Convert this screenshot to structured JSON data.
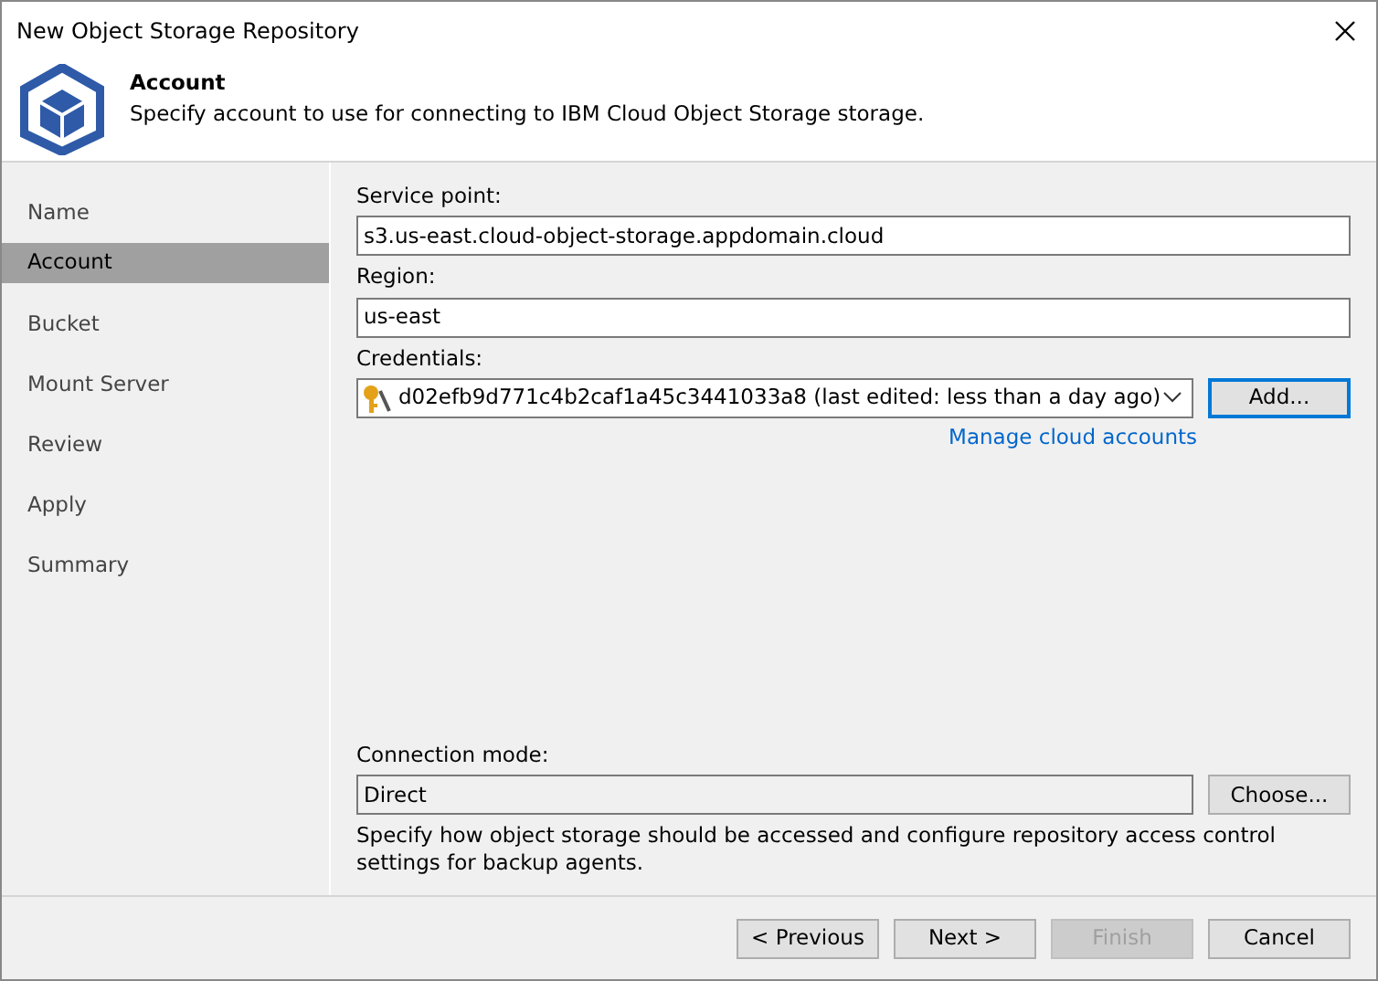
{
  "window": {
    "title": "New Object Storage Repository"
  },
  "header": {
    "title": "Account",
    "description": "Specify account to use for connecting to IBM Cloud Object Storage storage."
  },
  "steps": [
    {
      "label": "Name",
      "selected": false
    },
    {
      "label": "Account",
      "selected": true
    },
    {
      "label": "Bucket",
      "selected": false
    },
    {
      "label": "Mount Server",
      "selected": false
    },
    {
      "label": "Review",
      "selected": false
    },
    {
      "label": "Apply",
      "selected": false
    },
    {
      "label": "Summary",
      "selected": false
    }
  ],
  "service_point": {
    "label": "Service point:",
    "value": "s3.us-east.cloud-object-storage.appdomain.cloud"
  },
  "region": {
    "label": "Region:",
    "value": "us-east"
  },
  "credentials": {
    "label": "Credentials:",
    "value": "d02efb9d771c4b2caf1a45c3441033a8 (last edited: less than a day ago)",
    "button": {
      "label": "Add...",
      "focused": true
    },
    "link": "Manage cloud accounts"
  },
  "connection_mode": {
    "label": "Connection mode:",
    "value": "Direct",
    "readonly": true,
    "button": {
      "label": "Choose...",
      "focused": false
    },
    "description": "Specify how object storage should be accessed and configure repository access control settings for backup agents."
  },
  "buttons": [
    {
      "label": "< Previous",
      "disabled": false
    },
    {
      "label": "Next >",
      "disabled": false
    },
    {
      "label": "Finish",
      "disabled": true
    },
    {
      "label": "Cancel",
      "disabled": false
    }
  ]
}
